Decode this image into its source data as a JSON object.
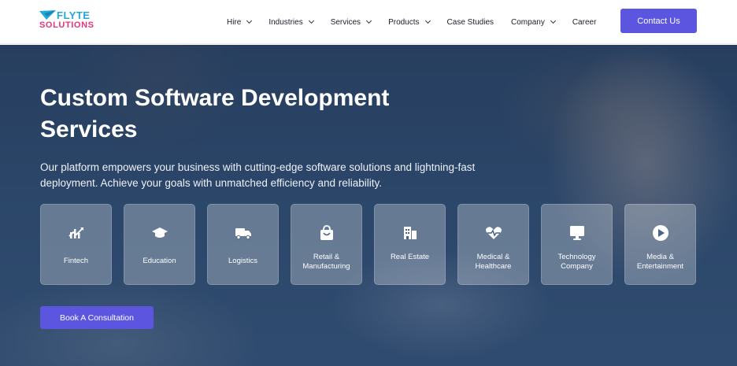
{
  "brand": {
    "name_top": "FLYTE",
    "name_bottom": "SOLUTIONS",
    "color_top": "#22a9d9",
    "color_bottom": "#e8327a"
  },
  "nav": {
    "items": [
      {
        "label": "Hire",
        "has_dropdown": true
      },
      {
        "label": "Industries",
        "has_dropdown": true
      },
      {
        "label": "Services",
        "has_dropdown": true
      },
      {
        "label": "Products",
        "has_dropdown": true
      },
      {
        "label": "Case Studies",
        "has_dropdown": false
      },
      {
        "label": "Company",
        "has_dropdown": true
      },
      {
        "label": "Career",
        "has_dropdown": false
      }
    ],
    "cta_label": "Contact Us"
  },
  "hero": {
    "title": "Custom Software Development Services",
    "description": "Our platform empowers your business with cutting-edge software solutions and lightning-fast deployment. Achieve your goals with unmatched efficiency and reliability.",
    "industries": [
      {
        "label": "Fintech",
        "icon": "fintech-icon"
      },
      {
        "label": "Education",
        "icon": "graduation-cap-icon"
      },
      {
        "label": "Logistics",
        "icon": "truck-icon"
      },
      {
        "label": "Retail & Manufacturing",
        "icon": "shopping-bag-icon"
      },
      {
        "label": "Real Estate",
        "icon": "building-icon"
      },
      {
        "label": "Medical & Healthcare",
        "icon": "heartbeat-icon"
      },
      {
        "label": "Technology Company",
        "icon": "monitor-icon"
      },
      {
        "label": "Media & Entertainment",
        "icon": "play-icon"
      }
    ],
    "book_label": "Book A Consultation"
  },
  "colors": {
    "accent": "#5b55e0",
    "hero_overlay": "#2d4a6e"
  }
}
